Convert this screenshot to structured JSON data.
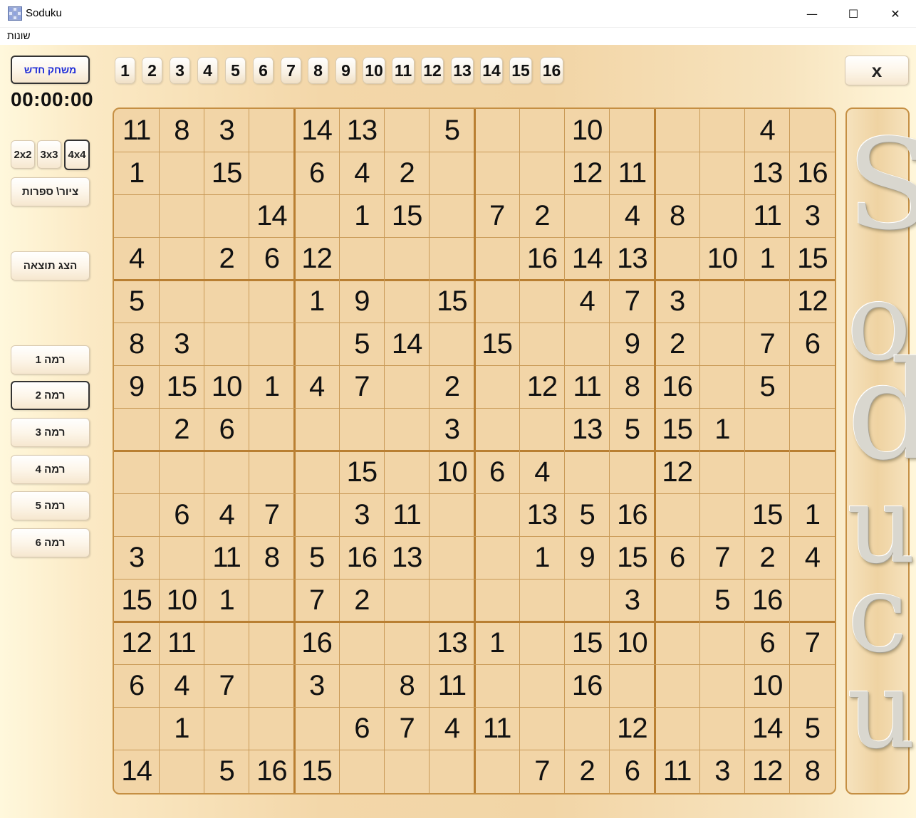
{
  "window": {
    "title": "Soduku",
    "minimize_glyph": "—",
    "maximize_glyph": "☐",
    "close_glyph": "✕"
  },
  "menu": {
    "item": "שונות"
  },
  "sidebar": {
    "new_game_label": "משחק חדש",
    "timer": "00:00:00",
    "size_buttons": [
      "2x2",
      "3x3",
      "4x4"
    ],
    "selected_size": "4x4",
    "number_drawing_label": "ציור\\ ספרות",
    "show_result_label": "הצג תוצאה",
    "levels": [
      "רמה 1",
      "רמה 2",
      "רמה 3",
      "רמה 4",
      "רמה 5",
      "רמה 6"
    ],
    "selected_level": "רמה 2"
  },
  "number_buttons": [
    "1",
    "2",
    "3",
    "4",
    "5",
    "6",
    "7",
    "8",
    "9",
    "10",
    "11",
    "12",
    "13",
    "14",
    "15",
    "16"
  ],
  "close_game_label": "x",
  "logo": {
    "letters": [
      "S",
      "o",
      "d",
      "u",
      "c",
      "u"
    ]
  },
  "colors": {
    "grid_line": "#c99a57",
    "block_line": "#b97f32",
    "new_game_text": "#1d2bd8"
  },
  "board": {
    "size": 16,
    "block": 4,
    "cells": [
      [
        "11",
        "8",
        "3",
        "",
        "14",
        "13",
        "",
        "5",
        "",
        "",
        "10",
        "",
        "",
        "",
        "4",
        ""
      ],
      [
        "1",
        "",
        "15",
        "",
        "6",
        "4",
        "2",
        "",
        "",
        "",
        "12",
        "11",
        "",
        "",
        "13",
        "16"
      ],
      [
        "",
        "",
        "",
        "14",
        "",
        "1",
        "15",
        "",
        "7",
        "2",
        "",
        "4",
        "8",
        "",
        "11",
        "3"
      ],
      [
        "4",
        "",
        "2",
        "6",
        "12",
        "",
        "",
        "",
        "",
        "16",
        "14",
        "13",
        "",
        "10",
        "1",
        "15"
      ],
      [
        "5",
        "",
        "",
        "",
        "1",
        "9",
        "",
        "15",
        "",
        "",
        "4",
        "7",
        "3",
        "",
        "",
        "12"
      ],
      [
        "8",
        "3",
        "",
        "",
        "",
        "5",
        "14",
        "",
        "15",
        "",
        "",
        "9",
        "2",
        "",
        "7",
        "6"
      ],
      [
        "9",
        "15",
        "10",
        "1",
        "4",
        "7",
        "",
        "2",
        "",
        "12",
        "11",
        "8",
        "16",
        "",
        "5",
        ""
      ],
      [
        "",
        "2",
        "6",
        "",
        "",
        "",
        "",
        "3",
        "",
        "",
        "13",
        "5",
        "15",
        "1",
        "",
        ""
      ],
      [
        "",
        "",
        "",
        "",
        "",
        "15",
        "",
        "10",
        "6",
        "4",
        "",
        "",
        "12",
        "",
        "",
        ""
      ],
      [
        "",
        "6",
        "4",
        "7",
        "",
        "3",
        "11",
        "",
        "",
        "13",
        "5",
        "16",
        "",
        "",
        "15",
        "1"
      ],
      [
        "3",
        "",
        "11",
        "8",
        "5",
        "16",
        "13",
        "",
        "",
        "1",
        "9",
        "15",
        "6",
        "7",
        "2",
        "4"
      ],
      [
        "15",
        "10",
        "1",
        "",
        "7",
        "2",
        "",
        "",
        "",
        "",
        "",
        "3",
        "",
        "5",
        "16",
        ""
      ],
      [
        "12",
        "11",
        "",
        "",
        "16",
        "",
        "",
        "13",
        "1",
        "",
        "15",
        "10",
        "",
        "",
        "6",
        "7"
      ],
      [
        "6",
        "4",
        "7",
        "",
        "3",
        "",
        "8",
        "11",
        "",
        "",
        "16",
        "",
        "",
        "",
        "10",
        ""
      ],
      [
        "",
        "1",
        "",
        "",
        "",
        "6",
        "7",
        "4",
        "11",
        "",
        "",
        "12",
        "",
        "",
        "14",
        "5"
      ],
      [
        "14",
        "",
        "5",
        "16",
        "15",
        "",
        "",
        "",
        "",
        "7",
        "2",
        "6",
        "11",
        "3",
        "12",
        "8"
      ]
    ]
  }
}
